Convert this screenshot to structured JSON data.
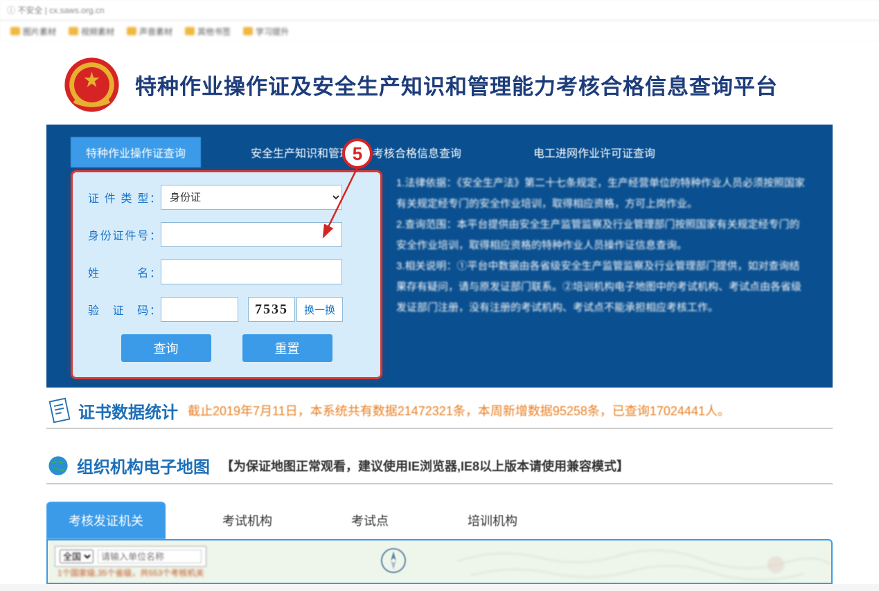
{
  "browser": {
    "security_label": "不安全",
    "url": "cx.saws.org.cn"
  },
  "bookmarks": [
    "图片素材",
    "视频素材",
    "声音素材",
    "其他书签",
    "学习提升"
  ],
  "header": {
    "title": "特种作业操作证及安全生产知识和管理能力考核合格信息查询平台"
  },
  "tabs": [
    {
      "label": "特种作业操作证查询",
      "active": true
    },
    {
      "label": "安全生产知识和管理能力考核合格信息查询",
      "active": false
    },
    {
      "label": "电工进网作业许可证查询",
      "active": false
    }
  ],
  "form": {
    "cert_type_label": "证 件 类 型：",
    "cert_type_value": "身份证",
    "id_number_label": "身份证件号：",
    "id_number_value": "",
    "name_label": "姓　　　名：",
    "name_value": "",
    "captcha_label": "验　证　码：",
    "captcha_value": "",
    "captcha_image": "7535",
    "captcha_refresh": "换一换",
    "submit": "查询",
    "reset": "重置"
  },
  "info_items": [
    "1.法律依据：《安全生产法》第二十七条规定，生产经营单位的特种作业人员必须按照国家有关规定经专门的安全作业培训，取得相应资格，方可上岗作业。",
    "2.查询范围：本平台提供由安全生产监管监察及行业管理部门按照国家有关规定经专门的安全作业培训，取得相应资格的特种作业人员操作证信息查询。",
    "3.相关说明：①平台中数据由各省级安全生产监管监察及行业管理部门提供，如对查询结果存有疑问，请与原发证部门联系。②培训机构电子地图中的考试机构、考试点由各省级发证部门注册，没有注册的考试机构、考试点不能承担相应考核工作。"
  ],
  "stats": {
    "title": "证书数据统计",
    "text": "截止2019年7月11日，本系统共有数据21472321条，本周新增数据95258条，已查询17024441人。"
  },
  "map": {
    "title": "组织机构电子地图",
    "note": "【为保证地图正常观看，建议使用IE浏览器,IE8以上版本请使用兼容模式】",
    "tabs": [
      {
        "label": "考核发证机关",
        "active": true
      },
      {
        "label": "考试机构",
        "active": false
      },
      {
        "label": "考试点",
        "active": false
      },
      {
        "label": "培训机构",
        "active": false
      }
    ],
    "region_select": "全国",
    "search_placeholder": "请输入单位名称",
    "substat": "1个国家级,35个省级，共553个考核机关"
  },
  "annotation": {
    "number": "5"
  }
}
